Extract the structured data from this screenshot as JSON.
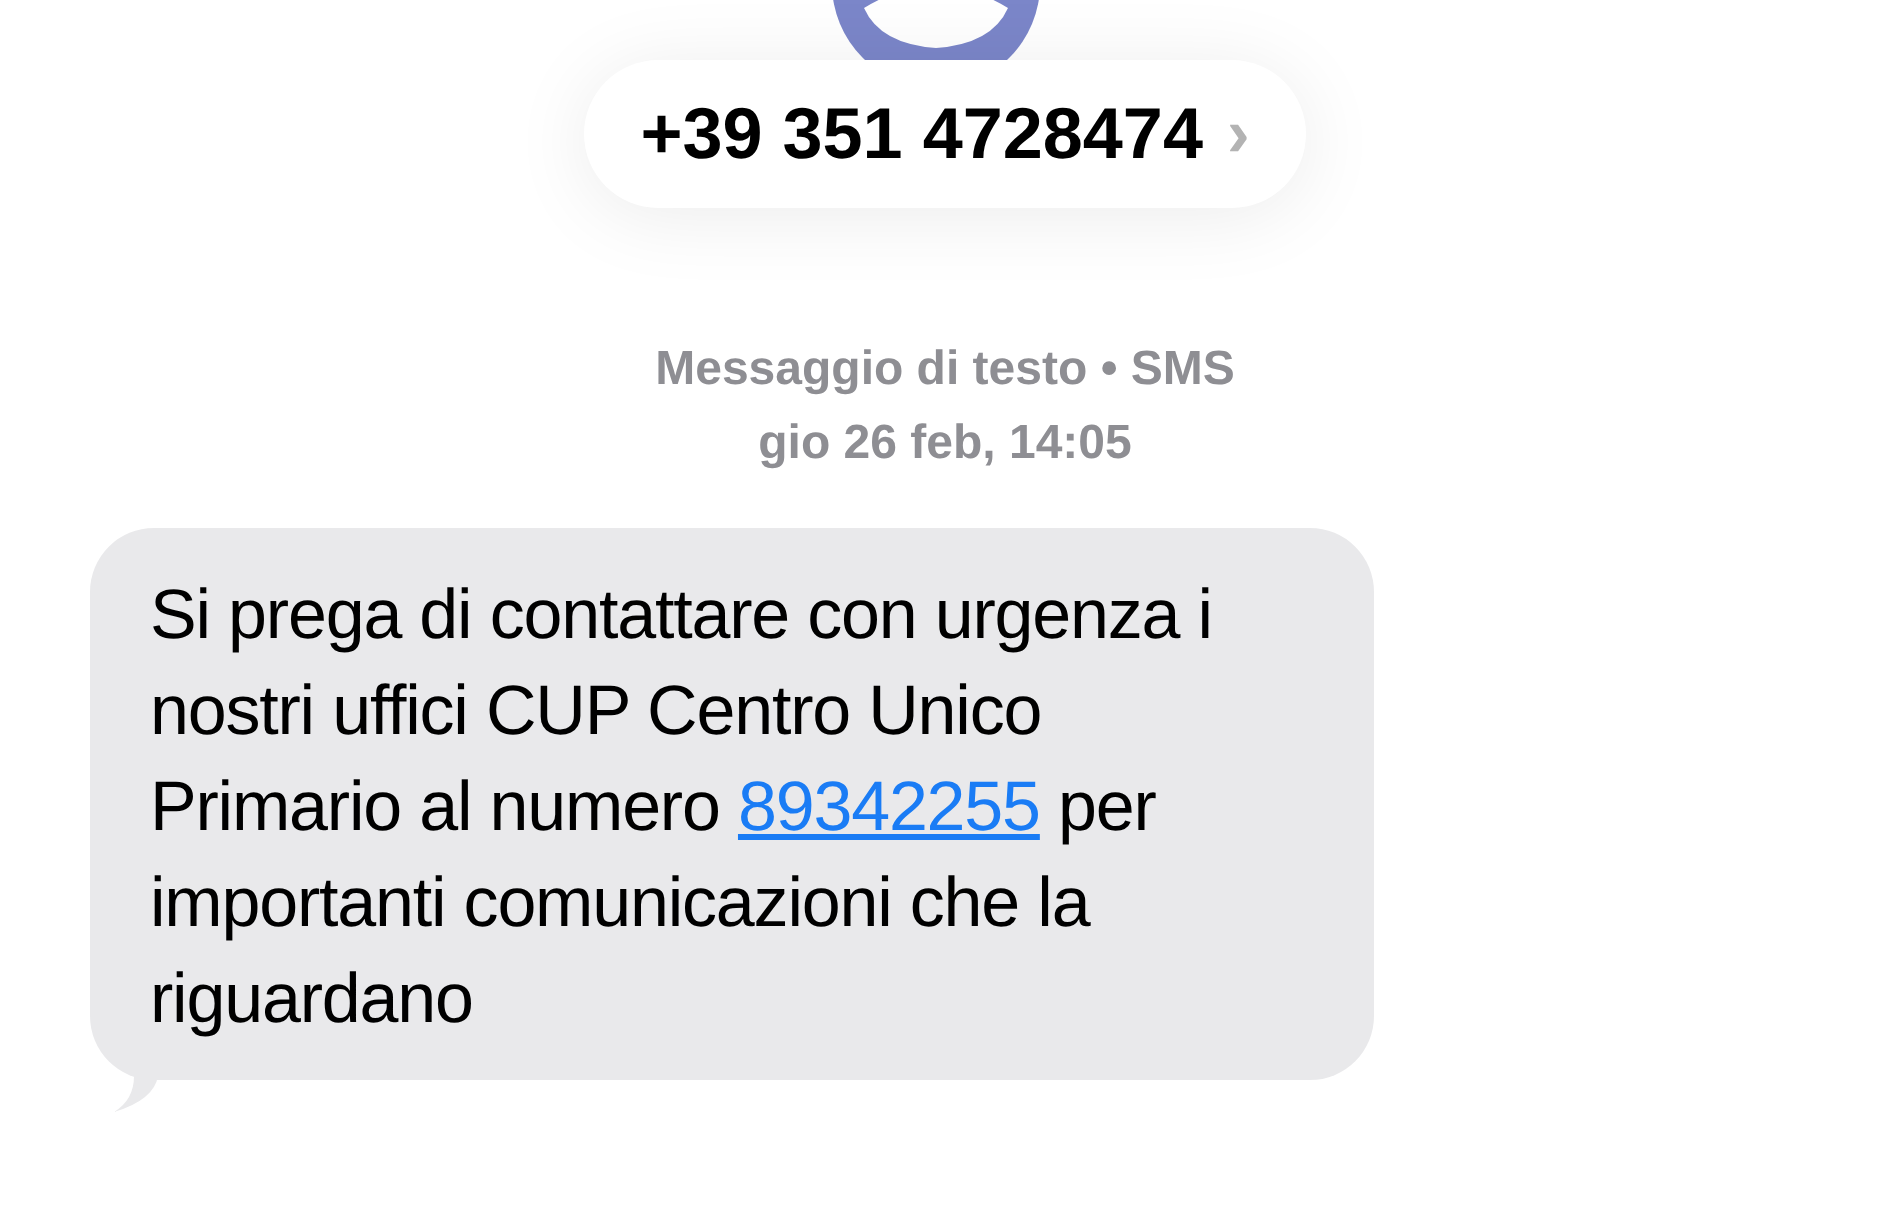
{
  "contact": {
    "name": "+39 351 4728474",
    "chevron": "›"
  },
  "meta": {
    "service": "Messaggio di testo • SMS",
    "timestamp": "gio 26 feb, 14:05"
  },
  "message": {
    "parts": [
      {
        "kind": "text",
        "text": "Si prega di contattare con urgenza i nostri uffici CUP Centro Unico Primario al numero "
      },
      {
        "kind": "link",
        "text": "89342255"
      },
      {
        "kind": "text",
        "text": " per importanti comunicazioni che la riguardano"
      }
    ]
  }
}
